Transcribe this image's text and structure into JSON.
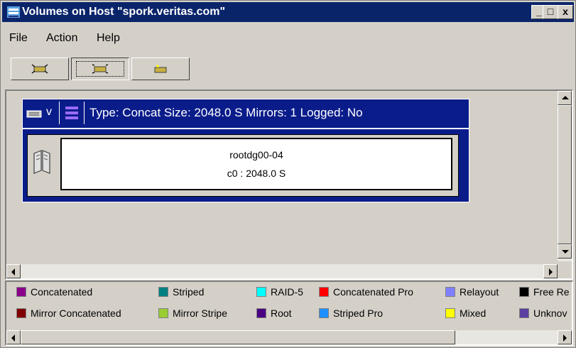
{
  "window": {
    "title": "Volumes on Host \"spork.veritas.com\"",
    "controls": {
      "minimize": "_",
      "maximize": "□",
      "close": "x"
    }
  },
  "menu": {
    "file": "File",
    "action": "Action",
    "help": "Help"
  },
  "volume": {
    "name_prefix": "v",
    "info": "Type: Concat  Size: 2048.0 S  Mirrors: 1  Logged: No",
    "subdisk": {
      "name": "rootdg00-04",
      "detail": "c0 : 2048.0 S"
    }
  },
  "legend": {
    "row1": [
      {
        "label": "Concatenated",
        "color": "#8b008b"
      },
      {
        "label": "Striped",
        "color": "#008080"
      },
      {
        "label": "RAID-5",
        "color": "#00ffff"
      },
      {
        "label": "Concatenated Pro",
        "color": "#ff0000"
      },
      {
        "label": "Relayout",
        "color": "#8080ff"
      },
      {
        "label": "Free Re",
        "color": "#000000"
      }
    ],
    "row2": [
      {
        "label": "Mirror Concatenated",
        "color": "#800000"
      },
      {
        "label": "Mirror Stripe",
        "color": "#9acd32"
      },
      {
        "label": "Root",
        "color": "#4b0082"
      },
      {
        "label": "Striped Pro",
        "color": "#1e90ff"
      },
      {
        "label": "Mixed",
        "color": "#ffff00"
      },
      {
        "label": "Unknov",
        "color": "#5a3fa0"
      }
    ]
  }
}
